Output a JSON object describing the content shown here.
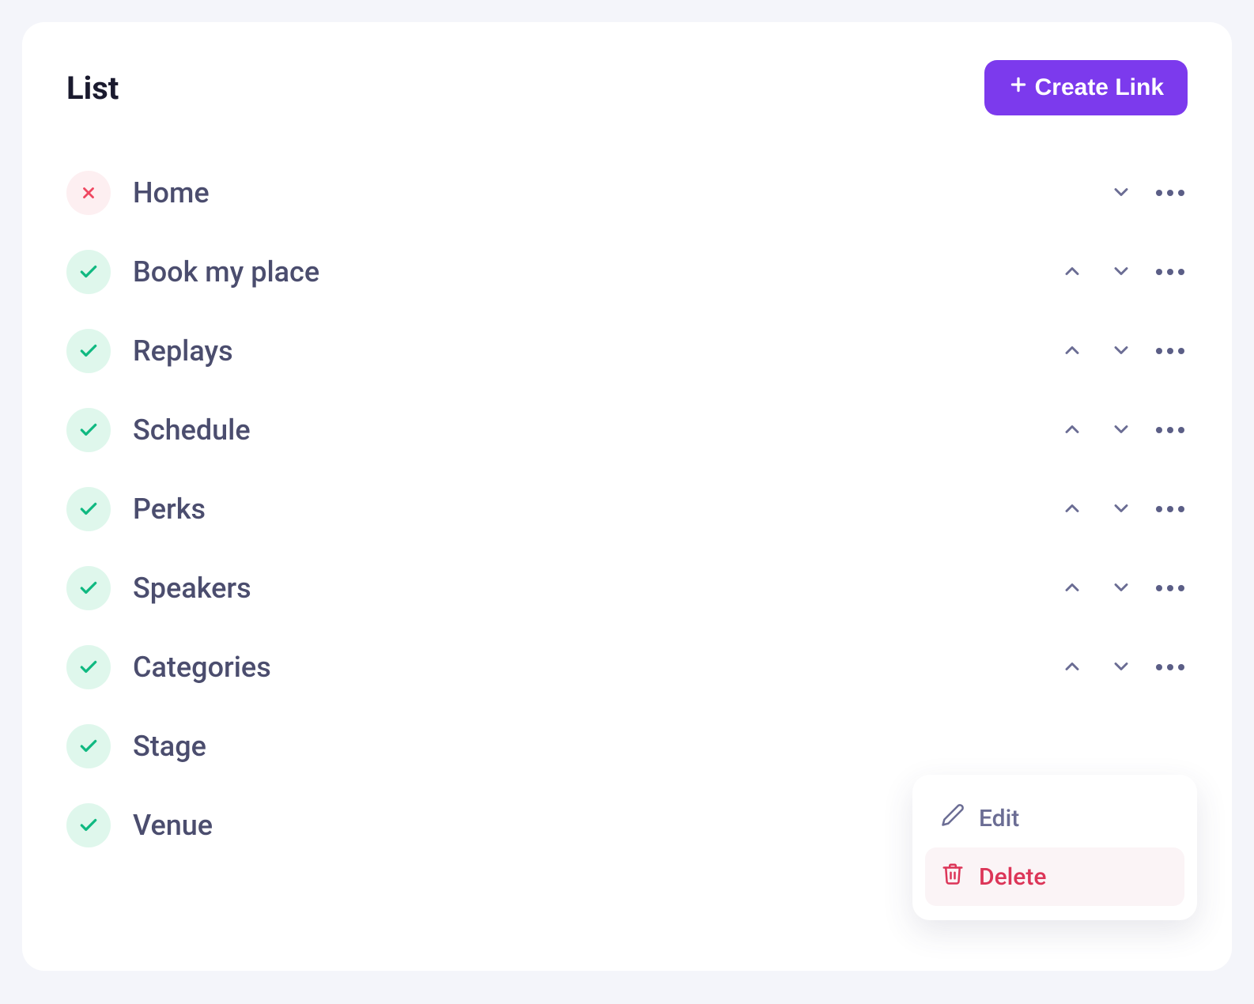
{
  "header": {
    "title": "List",
    "create_label": "Create Link"
  },
  "items": [
    {
      "label": "Home",
      "enabled": false,
      "can_up": false,
      "can_down": true
    },
    {
      "label": "Book my place",
      "enabled": true,
      "can_up": true,
      "can_down": true
    },
    {
      "label": "Replays",
      "enabled": true,
      "can_up": true,
      "can_down": true
    },
    {
      "label": "Schedule",
      "enabled": true,
      "can_up": true,
      "can_down": true
    },
    {
      "label": "Perks",
      "enabled": true,
      "can_up": true,
      "can_down": true
    },
    {
      "label": "Speakers",
      "enabled": true,
      "can_up": true,
      "can_down": true
    },
    {
      "label": "Categories",
      "enabled": true,
      "can_up": true,
      "can_down": true
    },
    {
      "label": "Stage",
      "enabled": true,
      "can_up": false,
      "can_down": false
    },
    {
      "label": "Venue",
      "enabled": true,
      "can_up": false,
      "can_down": false
    }
  ],
  "dropdown": {
    "edit_label": "Edit",
    "delete_label": "Delete"
  }
}
